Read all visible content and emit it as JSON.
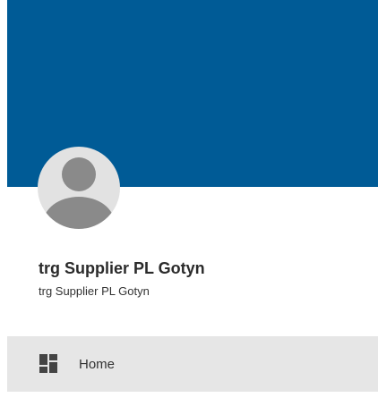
{
  "profile": {
    "name": "trg Supplier PL Gotyn",
    "subtitle": "trg Supplier PL Gotyn",
    "avatar_icon": "default-user-avatar-icon"
  },
  "colors": {
    "cover": "#005b96",
    "nav_background": "#e6e6e6",
    "avatar_background": "#e2e2e2",
    "avatar_silhouette": "#8a8a8a"
  },
  "nav": {
    "items": [
      {
        "label": "Home",
        "icon": "dashboard-icon"
      }
    ]
  }
}
